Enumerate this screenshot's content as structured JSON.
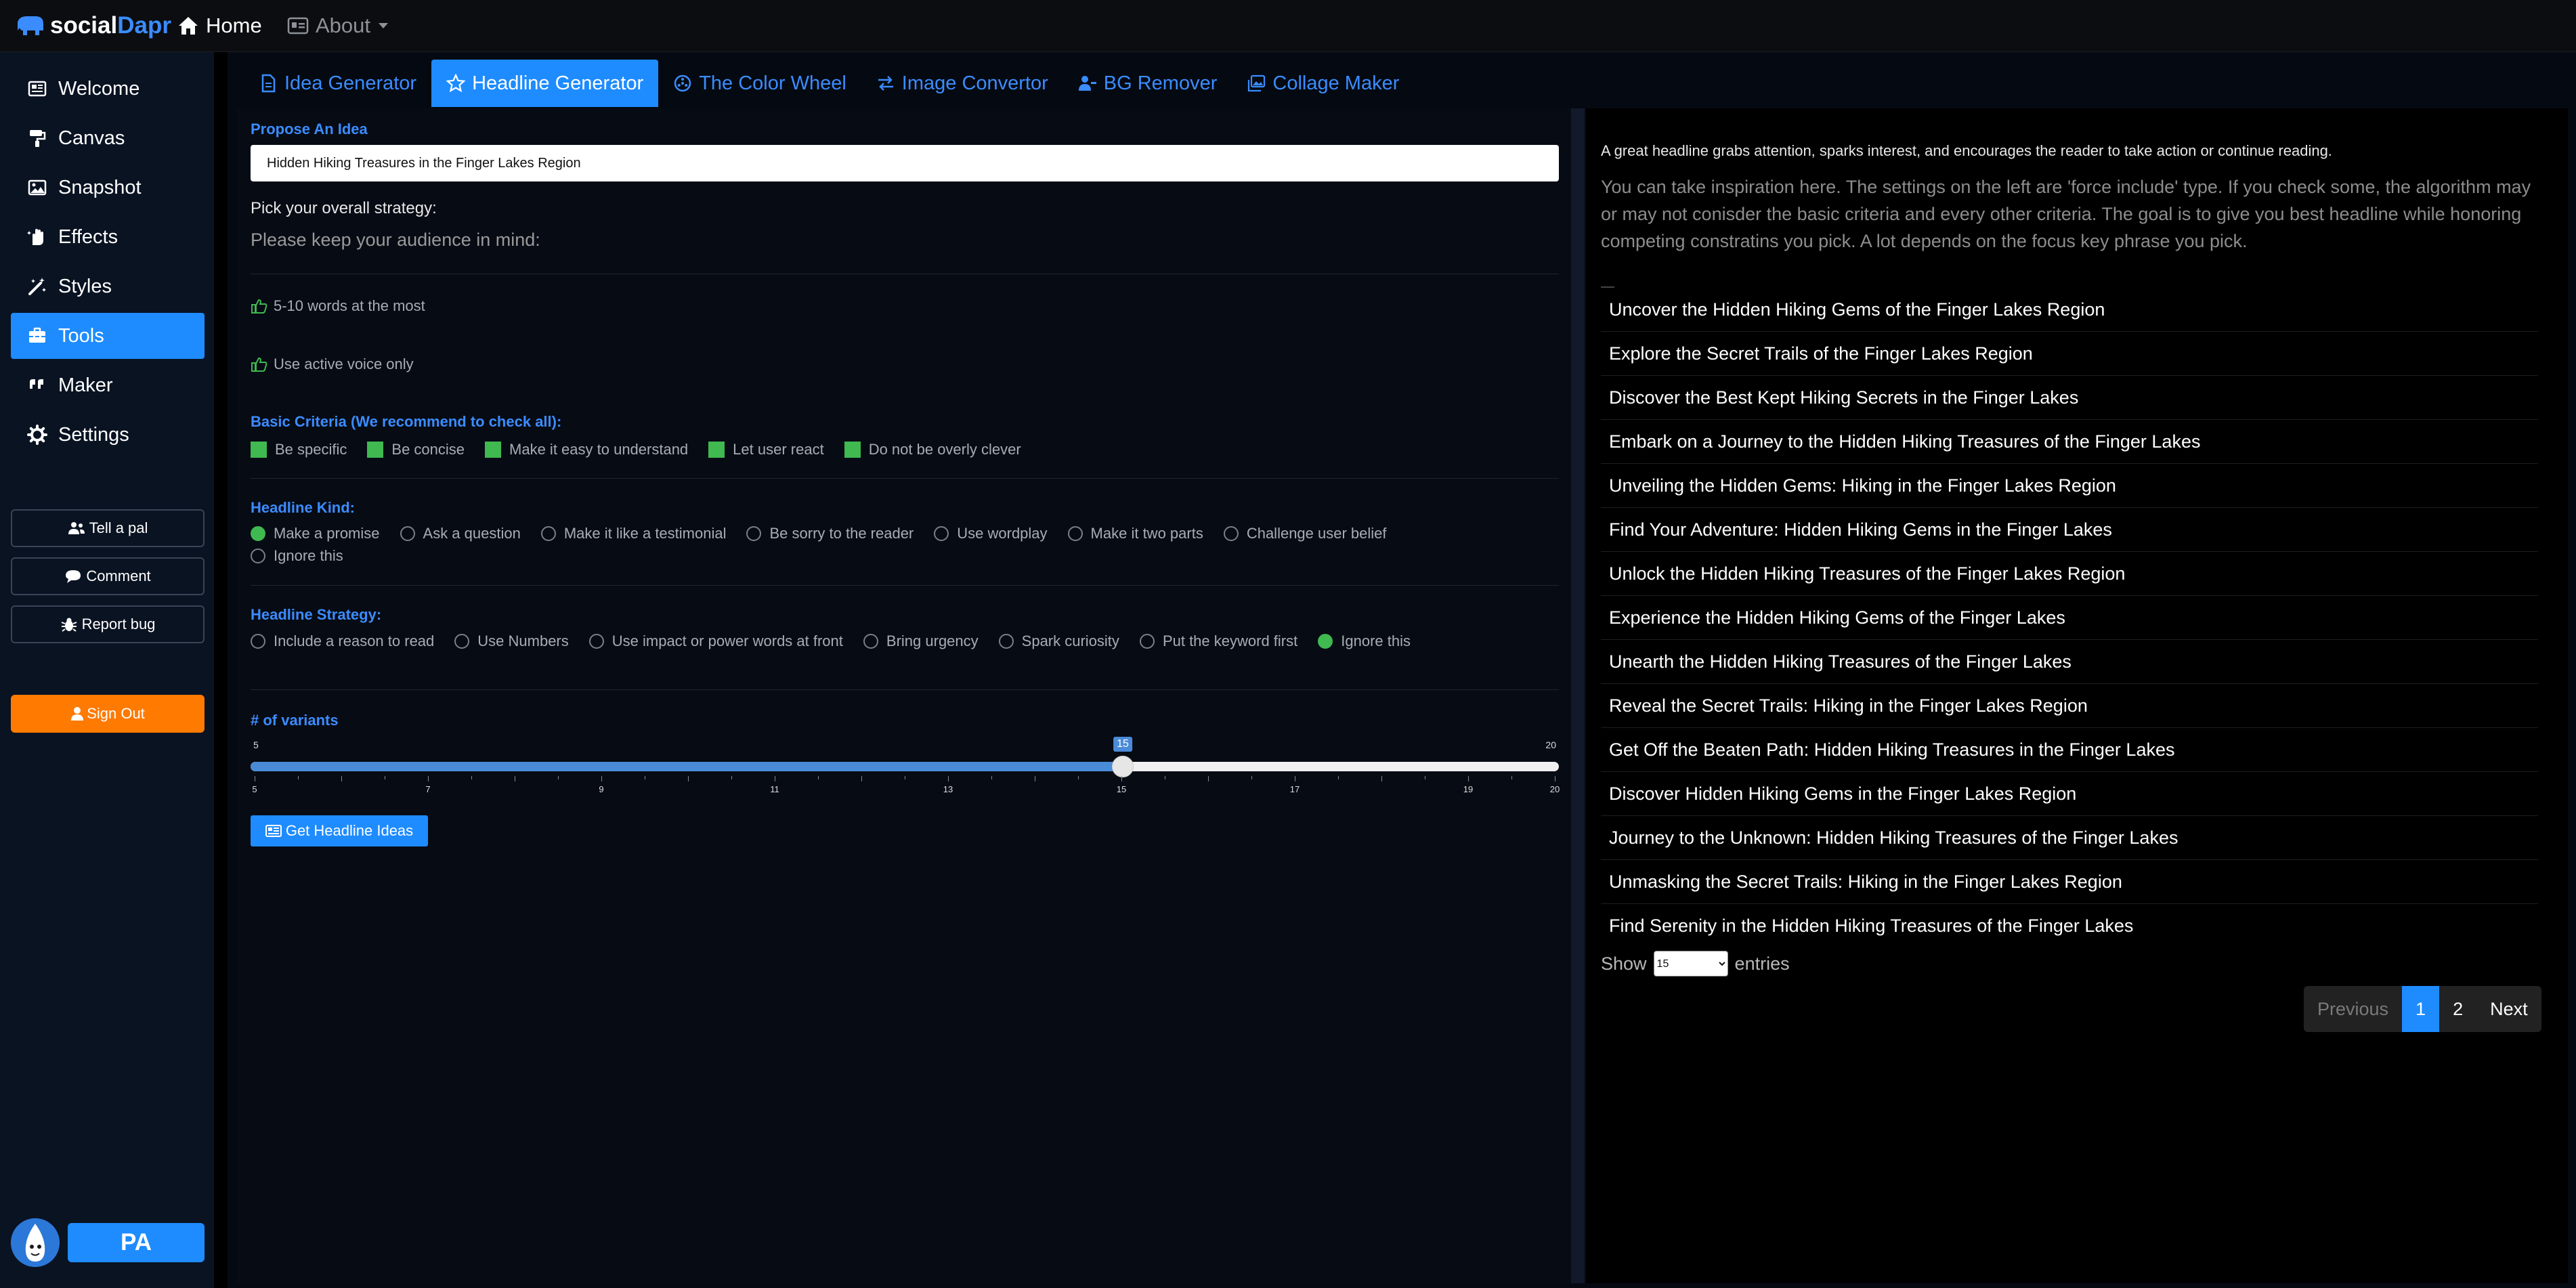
{
  "topnav": {
    "brand_part1": "social",
    "brand_part2": "Dapr",
    "home": "Home",
    "about": "About"
  },
  "sidebar": {
    "items": [
      {
        "label": "Welcome",
        "icon": "newspaper-icon"
      },
      {
        "label": "Canvas",
        "icon": "paint-roller-icon"
      },
      {
        "label": "Snapshot",
        "icon": "image-icon"
      },
      {
        "label": "Effects",
        "icon": "hand-sparkles-icon"
      },
      {
        "label": "Styles",
        "icon": "magic-wand-icon"
      },
      {
        "label": "Tools",
        "icon": "toolbox-icon",
        "active": true
      },
      {
        "label": "Maker",
        "icon": "quote-icon"
      },
      {
        "label": "Settings",
        "icon": "gear-icon"
      }
    ],
    "buttons": [
      "Tell a pal",
      "Comment",
      "Report bug"
    ],
    "sign_out": "Sign Out",
    "user_initials": "PA"
  },
  "tabs": [
    {
      "label": "Idea Generator",
      "icon": "file-icon"
    },
    {
      "label": "Headline Generator",
      "icon": "star-icon",
      "active": true
    },
    {
      "label": "The Color Wheel",
      "icon": "color-wheel-icon"
    },
    {
      "label": "Image Convertor",
      "icon": "arrows-exchange-icon"
    },
    {
      "label": "BG Remover",
      "icon": "user-minus-icon"
    },
    {
      "label": "Collage Maker",
      "icon": "images-icon"
    }
  ],
  "form": {
    "propose_label": "Propose An Idea",
    "idea_value": "Hidden Hiking Treasures in the Finger Lakes Region",
    "strategy_label": "Pick your overall strategy:",
    "audience_hint": "Please keep your audience in mind:",
    "rules": [
      "5-10 words at the most",
      "Use active voice only"
    ],
    "basic_criteria_label": "Basic Criteria (We recommend to check all):",
    "basic_criteria": [
      "Be specific",
      "Be concise",
      "Make it easy to understand",
      "Let user react",
      "Do not be overly clever"
    ],
    "headline_kind_label": "Headline Kind:",
    "headline_kinds": [
      "Make a promise",
      "Ask a question",
      "Make it like a testimonial",
      "Be sorry to the reader",
      "Use wordplay",
      "Make it two parts",
      "Challenge user belief",
      "Ignore this"
    ],
    "headline_kind_selected": "Make a promise",
    "headline_strategy_label": "Headline Strategy:",
    "headline_strategies": [
      "Include a reason to read",
      "Use Numbers",
      "Use impact or power words at front",
      "Bring urgency",
      "Spark curiosity",
      "Put the keyword first",
      "Ignore this"
    ],
    "headline_strategy_selected": "Ignore this",
    "variants_label": "# of variants",
    "slider": {
      "min": 5,
      "max": 20,
      "value": 15,
      "min_label": "5",
      "max_label": "20",
      "value_label": "15",
      "tick_labels": [
        "5",
        "7",
        "9",
        "11",
        "13",
        "15",
        "17",
        "19",
        "20"
      ]
    },
    "generate_button": "Get Headline Ideas"
  },
  "results": {
    "intro": "A great headline grabs attention, sparks interest, and encourages the reader to take action or continue reading.",
    "info": "You can take inspiration here. The settings on the left are 'force include' type. If you check some, the algorithm may or may not conisder the basic criteria and every other criteria. The goal is to give you best headline while honoring competing constratins you pick. A lot depends on the focus key phrase you pick.",
    "headlines": [
      "Uncover the Hidden Hiking Gems of the Finger Lakes Region",
      "Explore the Secret Trails of the Finger Lakes Region",
      "Discover the Best Kept Hiking Secrets in the Finger Lakes",
      "Embark on a Journey to the Hidden Hiking Treasures of the Finger Lakes",
      "Unveiling the Hidden Gems: Hiking in the Finger Lakes Region",
      "Find Your Adventure: Hidden Hiking Gems in the Finger Lakes",
      "Unlock the Hidden Hiking Treasures of the Finger Lakes Region",
      "Experience the Hidden Hiking Gems of the Finger Lakes",
      "Unearth the Hidden Hiking Treasures of the Finger Lakes",
      "Reveal the Secret Trails: Hiking in the Finger Lakes Region",
      "Get Off the Beaten Path: Hidden Hiking Treasures in the Finger Lakes",
      "Discover Hidden Hiking Gems in the Finger Lakes Region",
      "Journey to the Unknown: Hidden Hiking Treasures of the Finger Lakes",
      "Unmasking the Secret Trails: Hiking in the Finger Lakes Region",
      "Find Serenity in the Hidden Hiking Treasures of the Finger Lakes"
    ],
    "show_label": "Show",
    "entries_value": "15",
    "entries_label": "entries",
    "pagination": {
      "previous": "Previous",
      "pages": [
        "1",
        "2"
      ],
      "current": "1",
      "next": "Next"
    }
  },
  "colors": {
    "accent": "#1e8cff",
    "check_green": "#3fb950",
    "signout_orange": "#ff7a00"
  }
}
